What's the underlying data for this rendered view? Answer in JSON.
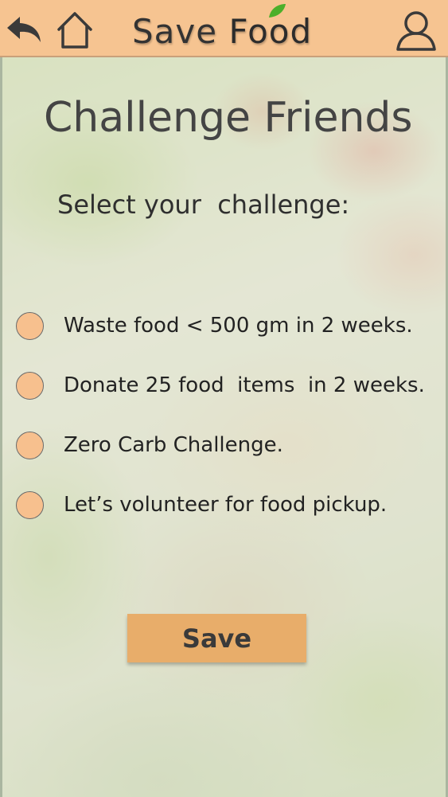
{
  "header": {
    "logo_word1": "Save",
    "logo_word2": "Food",
    "back_icon": "back-arrow-icon",
    "home_icon": "home-icon",
    "profile_icon": "user-profile-icon",
    "bg_color": "#f6c491"
  },
  "main": {
    "title": "Challenge Friends",
    "subtitle": "Select your  challenge:",
    "options": [
      {
        "label": "Waste food < 500 gm in 2 weeks."
      },
      {
        "label": "Donate 25 food  items  in 2 weeks."
      },
      {
        "label": "Zero Carb Challenge."
      },
      {
        "label": "Let’s volunteer for food pickup."
      }
    ],
    "save_label": "Save"
  },
  "colors": {
    "radio_fill": "#f7c08e",
    "button_fill": "#e8ad6a"
  }
}
